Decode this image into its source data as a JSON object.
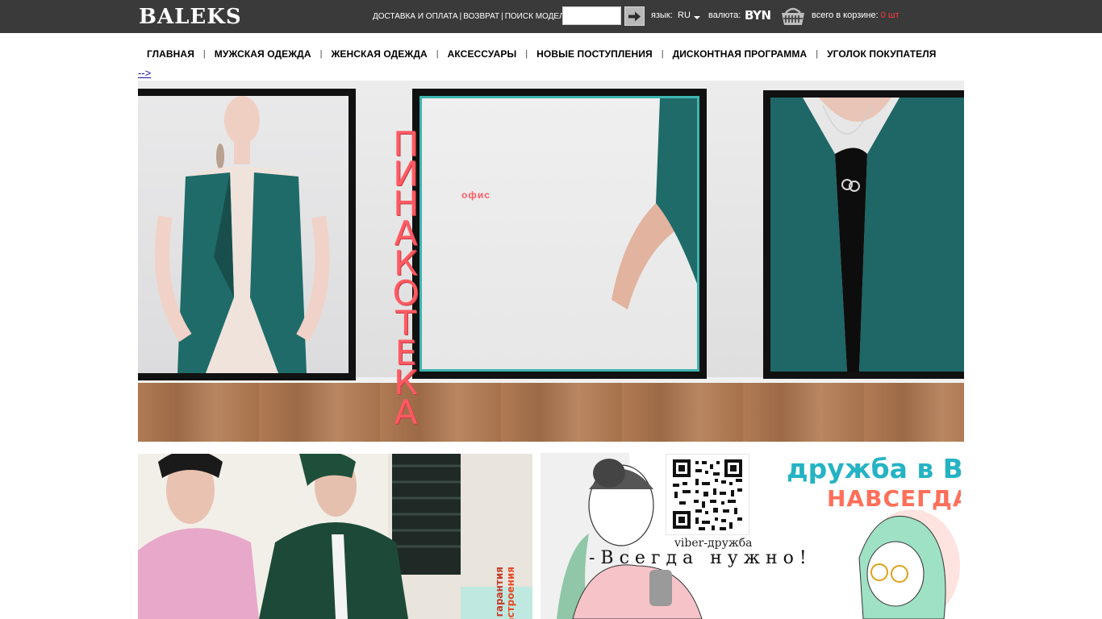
{
  "header": {
    "logo": "BALEKS",
    "links": [
      "ДОСТАВКА И ОПЛАТА",
      "ВОЗВРАТ",
      "ПОИСК МОДЕЛЕЙ:"
    ],
    "search": {
      "value": "",
      "placeholder": ""
    },
    "search_button_icon": "arrow-right-icon",
    "language_label": "язык:",
    "language_value": "RU",
    "currency_label": "валюта:",
    "currency_value": "BYN",
    "cart_icon": "basket-icon",
    "cart_label": "всего в корзине:",
    "cart_count": "0 шт",
    "colors": {
      "bar": "#3a3a3a",
      "cart_count": "#ff3b3b"
    }
  },
  "nav": {
    "items": [
      "ГЛАВНАЯ",
      "МУЖСКАЯ ОДЕЖДА",
      "ЖЕНСКАЯ ОДЕЖДА",
      "АКСЕССУАРЫ",
      "НОВЫЕ ПОСТУПЛЕНИЯ",
      "ДИСКОНТНАЯ ПРОГРАММА",
      "УГОЛОК ПОКУПАТЕЛЯ"
    ],
    "separator": "|"
  },
  "stray_link": "-->",
  "hero": {
    "vertical_word": [
      "П",
      "И",
      "Н",
      "А",
      "К",
      "О",
      "Т",
      "Е",
      "К",
      "А"
    ],
    "office_label": "офис",
    "accent_color": "#ff5a63"
  },
  "banner_left": {
    "side_text_1": "гарантия",
    "side_text_2": "настроения"
  },
  "banner_right": {
    "title": "дружба в ВК",
    "subtitle": "НАВСЕГДА!",
    "viber_label": "viber-дружба",
    "always_label": "-Всегда нужно!",
    "title_color": "#25b3c4",
    "subtitle_color": "#ff6f5a"
  }
}
